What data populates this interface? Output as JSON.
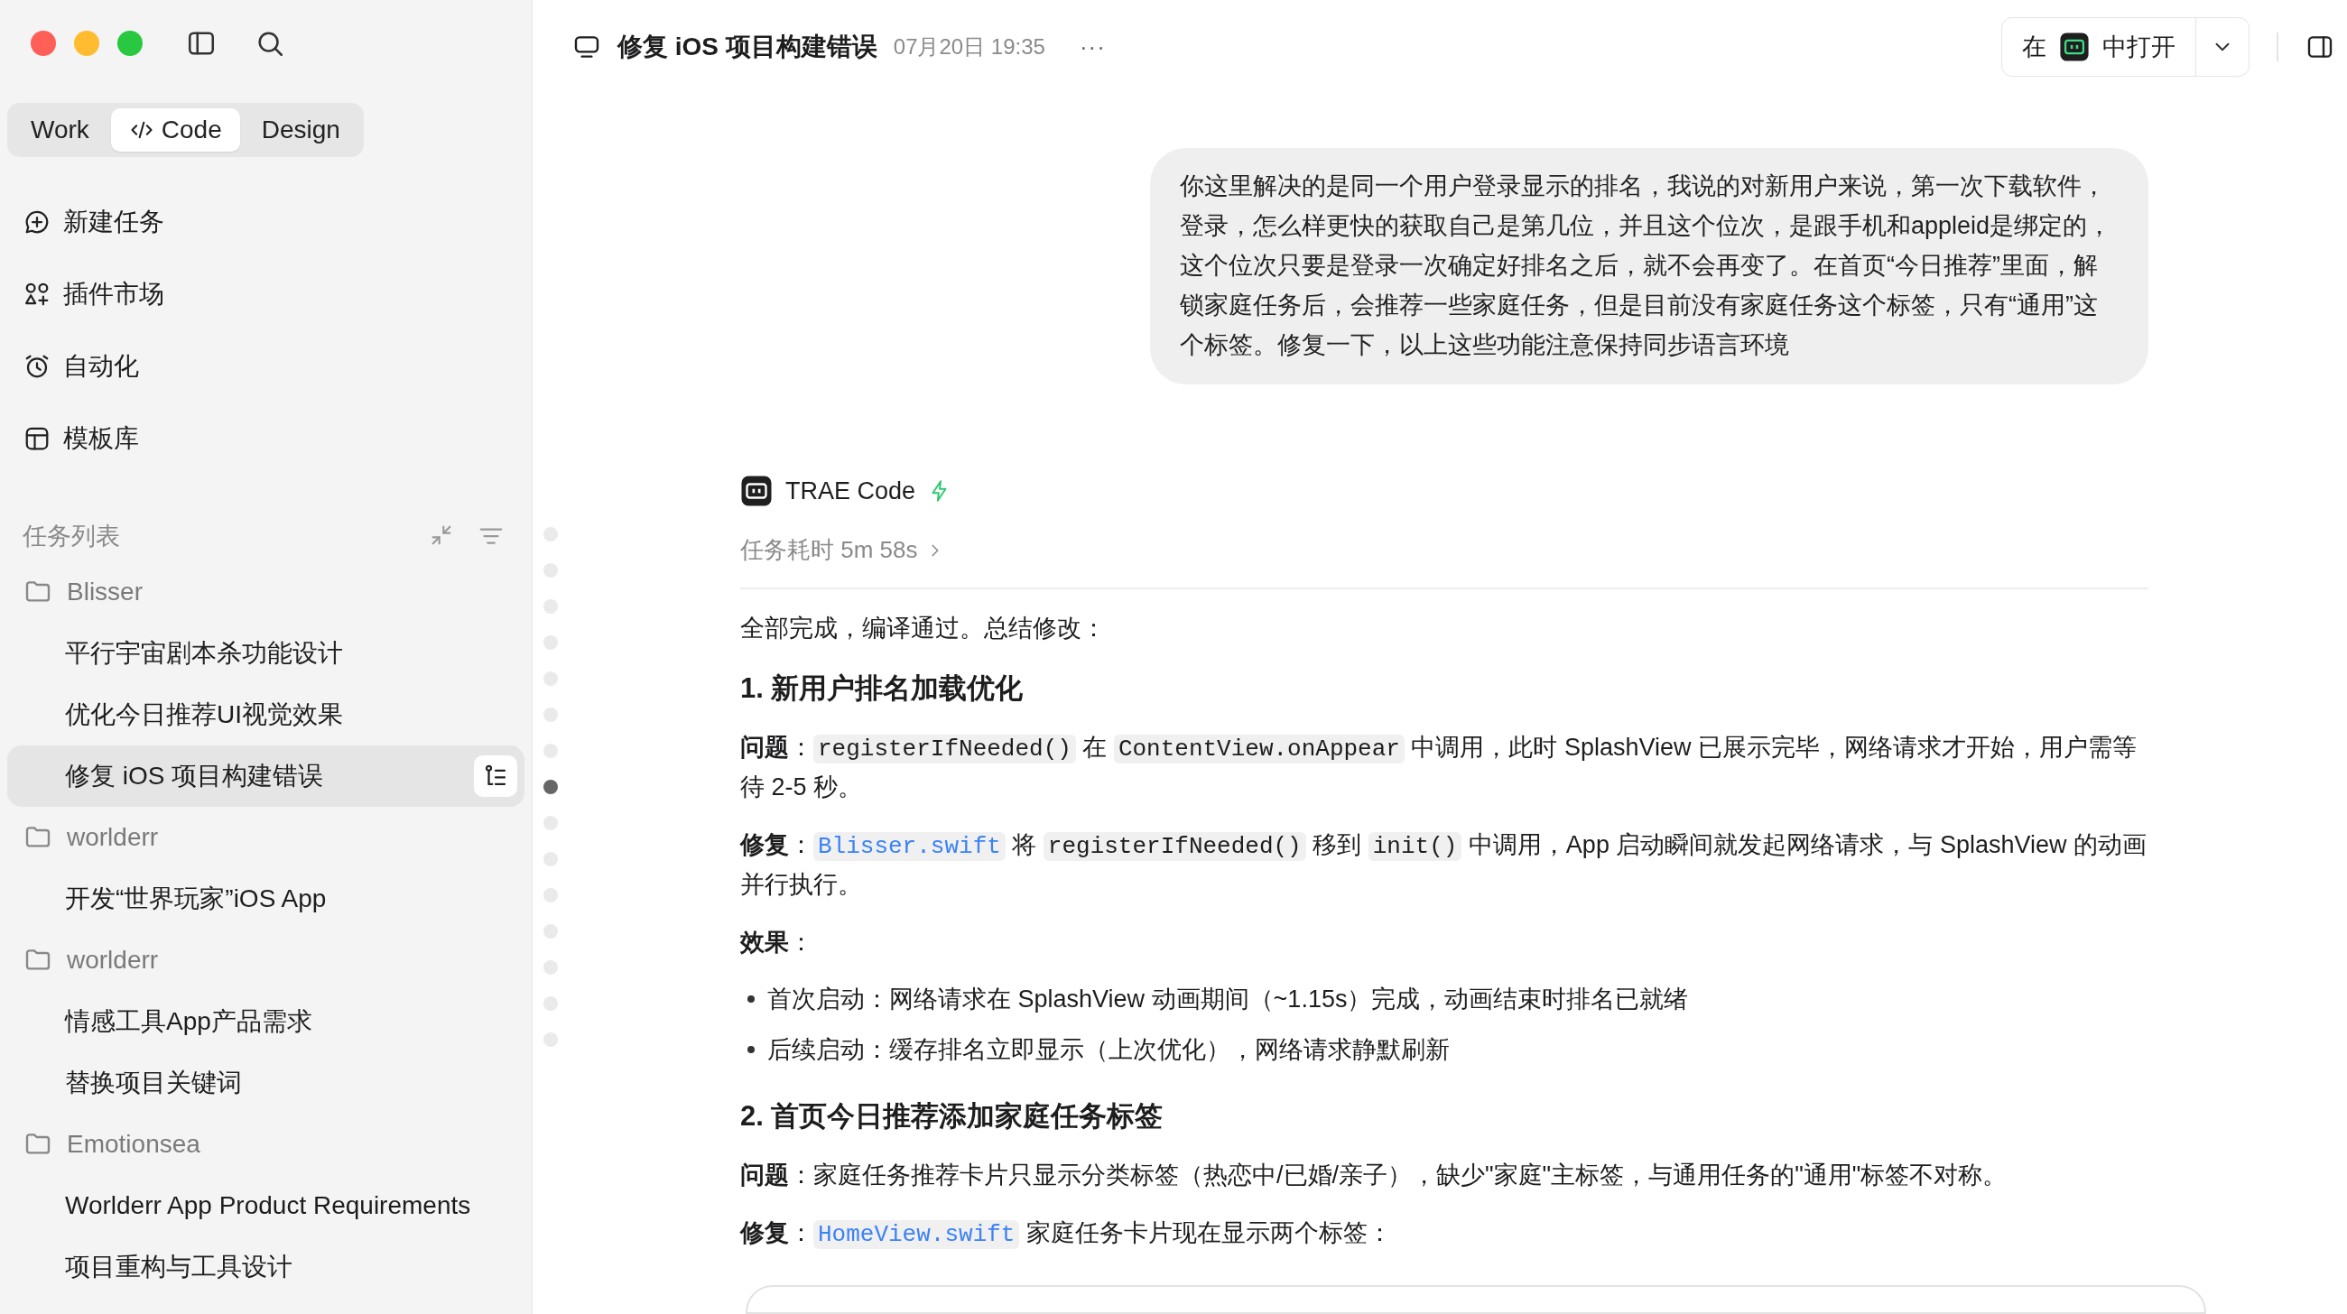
{
  "mode_tabs": [
    {
      "label": "Work",
      "selected": false
    },
    {
      "label": "Code",
      "selected": true
    },
    {
      "label": "Design",
      "selected": false
    }
  ],
  "nav": [
    {
      "label": "新建任务"
    },
    {
      "label": "插件市场"
    },
    {
      "label": "自动化"
    },
    {
      "label": "模板库"
    }
  ],
  "task_list": {
    "title": "任务列表",
    "groups": [
      {
        "name": "Blisser",
        "children": [
          {
            "label": "平行宇宙剧本杀功能设计",
            "selected": false
          },
          {
            "label": "优化今日推荐UI视觉效果",
            "selected": false
          },
          {
            "label": "修复 iOS 项目构建错误",
            "selected": true
          }
        ]
      },
      {
        "name": "worlderr",
        "children": [
          {
            "label": "开发“世界玩家”iOS App",
            "selected": false
          }
        ]
      },
      {
        "name": "worlderr",
        "children": [
          {
            "label": "情感工具App产品需求",
            "selected": false
          },
          {
            "label": "替换项目关键词",
            "selected": false
          }
        ]
      },
      {
        "name": "Emotionsea",
        "children": [
          {
            "label": "Worlderr App Product Requirements",
            "selected": false
          },
          {
            "label": "项目重构与工具设计",
            "selected": false
          }
        ]
      }
    ]
  },
  "header": {
    "title": "修复 iOS 项目构建错误",
    "time": "07月20日 19:35",
    "more": "···",
    "open_in": {
      "prefix": "在",
      "suffix": "中打开"
    }
  },
  "turn_markers": [
    {
      "selected": false
    },
    {
      "selected": false
    },
    {
      "selected": false
    },
    {
      "selected": false
    },
    {
      "selected": false
    },
    {
      "selected": false
    },
    {
      "selected": false
    },
    {
      "selected": true
    },
    {
      "selected": false
    },
    {
      "selected": false
    },
    {
      "selected": false
    },
    {
      "selected": false
    },
    {
      "selected": false
    },
    {
      "selected": false
    },
    {
      "selected": false
    }
  ],
  "user_message": "你这里解决的是同一个用户登录显示的排名，我说的对新用户来说，第一次下载软件，登录，怎么样更快的获取自己是第几位，并且这个位次，是跟手机和appleid是绑定的，这个位次只要是登录一次确定好排名之后，就不会再变了。在首页“今日推荐”里面，解锁家庭任务后，会推荐一些家庭任务，但是目前没有家庭任务这个标签，只有“通用”这个标签。修复一下，以上这些功能注意保持同步语言环境",
  "assistant": {
    "name": "TRAE Code",
    "duration": "任务耗时 5m 58s",
    "blocks": [
      {
        "kind": "paragraph",
        "parts": [
          {
            "kind": "text",
            "text": "全部完成，编译通过。总结修改："
          }
        ]
      },
      {
        "kind": "heading",
        "text": "1. 新用户排名加载优化"
      },
      {
        "kind": "paragraph",
        "parts": [
          {
            "kind": "label",
            "text": "问题"
          },
          {
            "kind": "text",
            "text": "："
          },
          {
            "kind": "code",
            "text": "registerIfNeeded()"
          },
          {
            "kind": "text",
            "text": " 在 "
          },
          {
            "kind": "code",
            "text": "ContentView.onAppear"
          },
          {
            "kind": "text",
            "text": " 中调用，此时 SplashView 已展示完毕，网络请求才开始，用户需等待 2-5 秒。"
          }
        ]
      },
      {
        "kind": "paragraph",
        "parts": [
          {
            "kind": "label",
            "text": "修复"
          },
          {
            "kind": "text",
            "text": "："
          },
          {
            "kind": "file",
            "text": "Blisser.swift"
          },
          {
            "kind": "text",
            "text": " 将 "
          },
          {
            "kind": "code",
            "text": "registerIfNeeded()"
          },
          {
            "kind": "text",
            "text": " 移到 "
          },
          {
            "kind": "code",
            "text": "init()"
          },
          {
            "kind": "text",
            "text": " 中调用，App 启动瞬间就发起网络请求，与 SplashView 的动画并行执行。"
          }
        ]
      },
      {
        "kind": "paragraph",
        "parts": [
          {
            "kind": "label",
            "text": "效果"
          },
          {
            "kind": "text",
            "text": "："
          }
        ]
      },
      {
        "kind": "bullets",
        "items": [
          "首次启动：网络请求在 SplashView 动画期间（~1.15s）完成，动画结束时排名已就绪",
          "后续启动：缓存排名立即显示（上次优化），网络请求静默刷新"
        ]
      },
      {
        "kind": "heading",
        "text": "2. 首页今日推荐添加家庭任务标签"
      },
      {
        "kind": "paragraph",
        "parts": [
          {
            "kind": "label",
            "text": "问题"
          },
          {
            "kind": "text",
            "text": "：家庭任务推荐卡片只显示分类标签（热恋中/已婚/亲子），缺少\"家庭\"主标签，与通用任务的\"通用\"标签不对称。"
          }
        ]
      },
      {
        "kind": "paragraph",
        "parts": [
          {
            "kind": "label",
            "text": "修复"
          },
          {
            "kind": "text",
            "text": "："
          },
          {
            "kind": "file",
            "text": "HomeView.swift"
          },
          {
            "kind": "text",
            "text": " 家庭任务卡片现在显示两个标签："
          }
        ]
      }
    ]
  }
}
